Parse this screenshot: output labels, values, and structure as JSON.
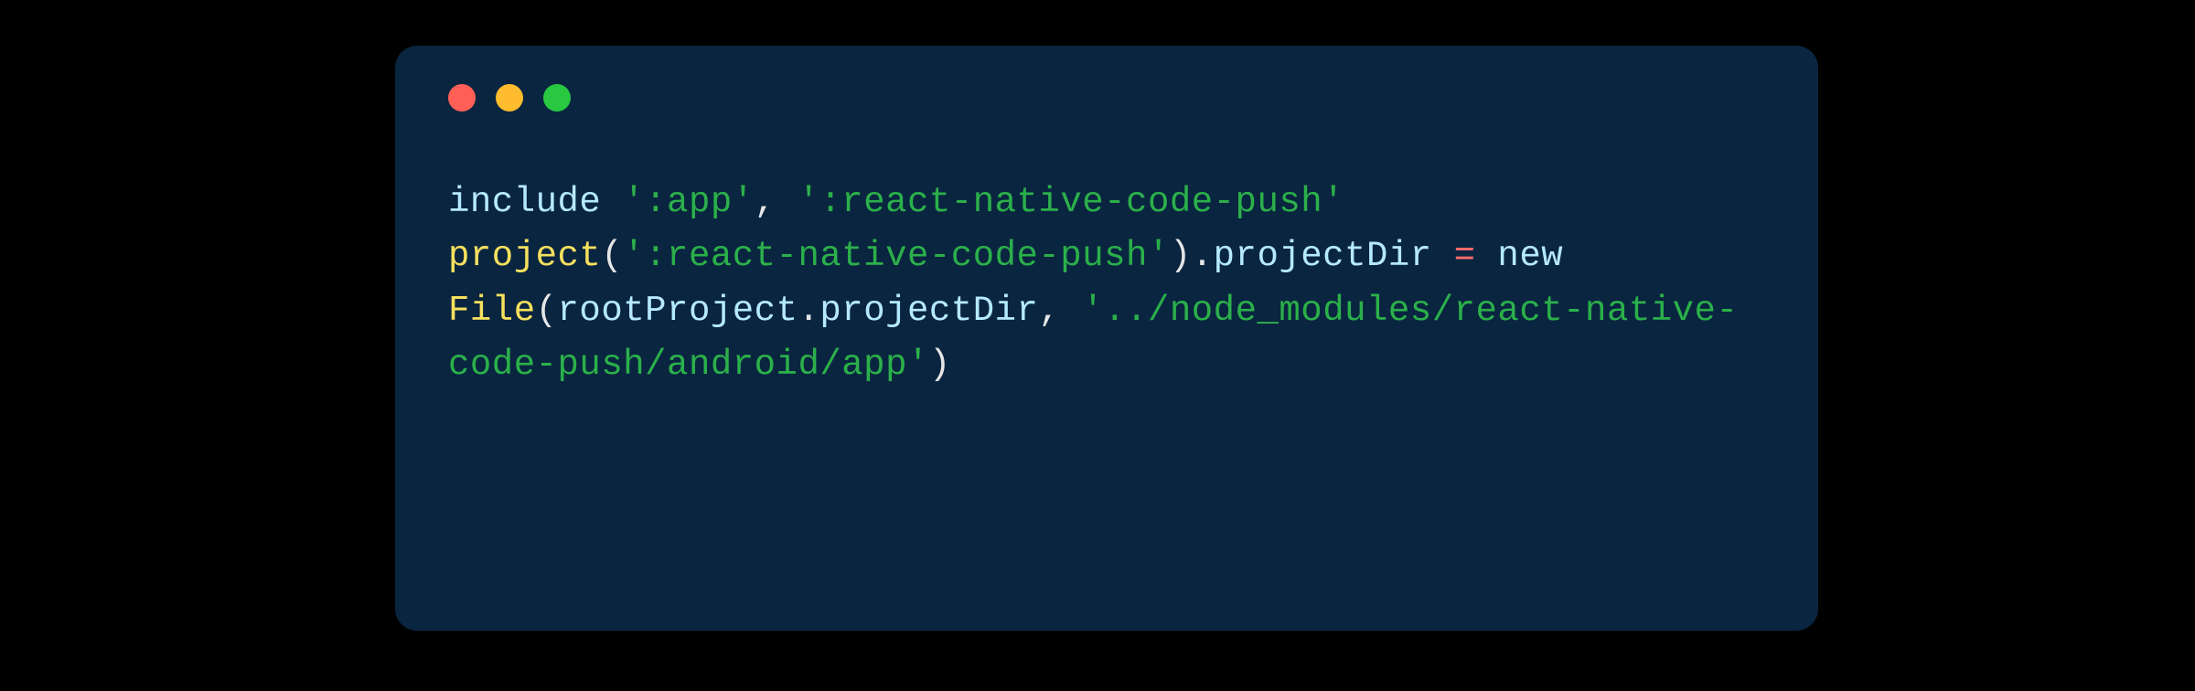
{
  "colors": {
    "background": "#000000",
    "window_bg": "#0a2540",
    "traffic_red": "#ff5f57",
    "traffic_yellow": "#febc2e",
    "traffic_green": "#28c840",
    "keyword": "#b5e9ff",
    "string": "#2bb04a",
    "func": "#f6e05e",
    "ident": "#b5e9ff",
    "punct": "#e6e6e6",
    "oper": "#ff6b6b"
  },
  "code": {
    "language": "gradle",
    "raw": "include ':app', ':react-native-code-push'\nproject(':react-native-code-push').projectDir = new File(rootProject.projectDir, '../node_modules/react-native-code-push/android/app')",
    "tokens": {
      "include": "include",
      "str_app": "':app'",
      "comma_space": ", ",
      "str_rncp": "':react-native-code-push'",
      "project": "project",
      "lparen": "(",
      "rparen": ")",
      "dot": ".",
      "projectDir": "projectDir",
      "space": " ",
      "equals": "=",
      "nl": "\n",
      "new": "new",
      "File": "File",
      "rootProject": "rootProject",
      "str_path": "'../node_modules/react-native-code-push/android/app'"
    }
  }
}
